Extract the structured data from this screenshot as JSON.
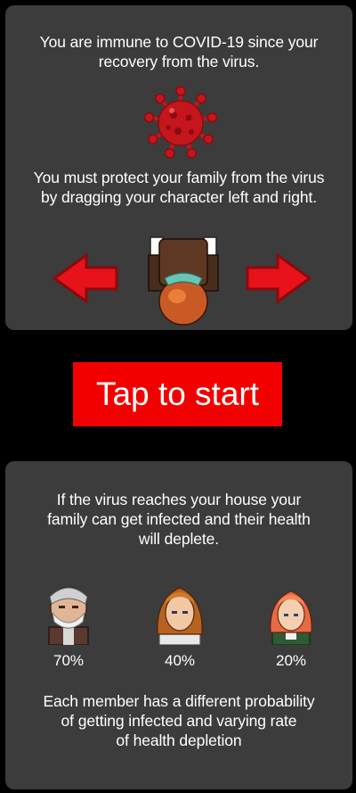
{
  "intro": {
    "lines": [
      "You are immune to COVID-19 since your",
      "recovery from the virus."
    ]
  },
  "instructions": {
    "lines": [
      "You must protect your family from the virus",
      "by dragging your character left and right."
    ]
  },
  "start_button": {
    "label": "Tap to start"
  },
  "infection_info": {
    "lines": [
      "If the virus reaches your house your",
      "family can get infected and their health",
      "will deplete."
    ]
  },
  "family": [
    {
      "name": "grandfather",
      "probability": "70%"
    },
    {
      "name": "mother",
      "probability": "40%"
    },
    {
      "name": "daughter",
      "probability": "20%"
    }
  ],
  "probability_info": {
    "lines": [
      "Each member has a different probability",
      "of getting infected and varying rate",
      "of health depletion"
    ]
  },
  "icons": {
    "virus": "coronavirus-icon",
    "left": "arrow-left-icon",
    "right": "arrow-right-icon",
    "player": "player-character-sprite"
  },
  "colors": {
    "background": "#000000",
    "panel": "#3c3c3c",
    "button": "#f20000",
    "arrow": "#e8121a",
    "virus": "#c4161c",
    "text": "#ffffff"
  }
}
